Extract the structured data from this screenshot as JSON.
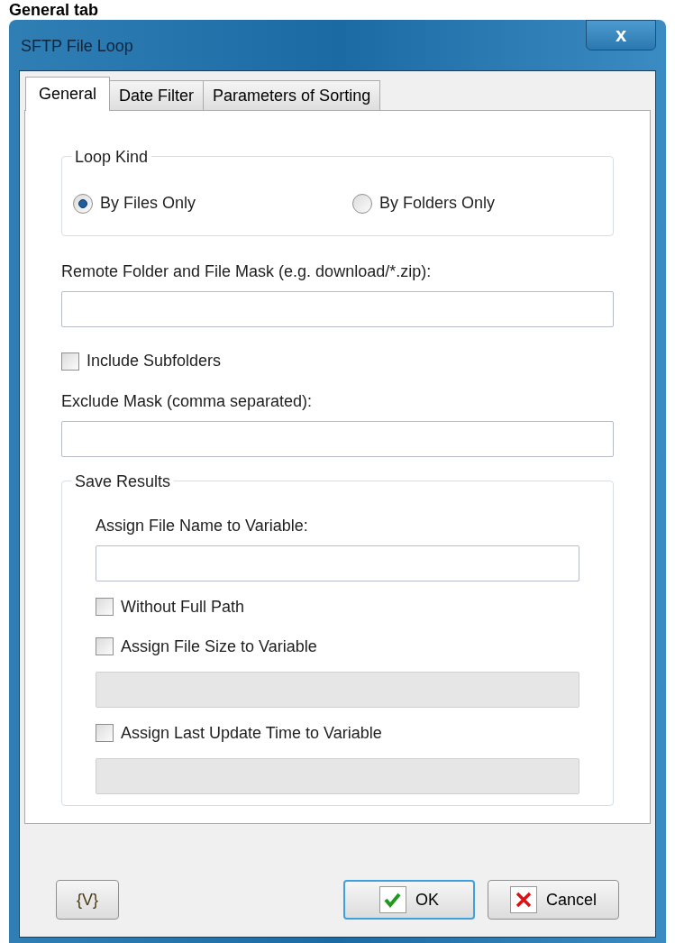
{
  "page_heading": "General tab",
  "window": {
    "title": "SFTP File Loop",
    "close_label": "x"
  },
  "tabs": [
    {
      "label": "General",
      "selected": true
    },
    {
      "label": "Date Filter",
      "selected": false
    },
    {
      "label": "Parameters of Sorting",
      "selected": false
    }
  ],
  "loop_kind": {
    "title": "Loop Kind",
    "options": [
      {
        "label": "By Files Only",
        "selected": true
      },
      {
        "label": "By Folders Only",
        "selected": false
      }
    ]
  },
  "remote_folder": {
    "label": "Remote Folder and File Mask (e.g. download/*.zip):"
  },
  "include_subfolders": {
    "label": "Include Subfolders",
    "checked": false
  },
  "exclude_mask": {
    "label": "Exclude Mask (comma separated):"
  },
  "save_results": {
    "title": "Save Results",
    "items": [
      {
        "kind": "label",
        "label": "Assign File Name to Variable:"
      },
      {
        "kind": "field",
        "disabled": false
      },
      {
        "kind": "checkbox",
        "label": "Without Full Path",
        "checked": false
      },
      {
        "kind": "checkbox",
        "label": "Assign File Size to Variable",
        "checked": false
      },
      {
        "kind": "field",
        "disabled": true
      },
      {
        "kind": "checkbox",
        "label": "Assign Last Update Time to Variable",
        "checked": false
      },
      {
        "kind": "field",
        "disabled": true
      }
    ]
  },
  "buttons": [
    {
      "kind": "variables",
      "label": "{V}",
      "default": false
    },
    {
      "kind": "ok",
      "label": "OK",
      "default": true
    },
    {
      "kind": "cancel",
      "label": "Cancel",
      "default": false
    }
  ]
}
